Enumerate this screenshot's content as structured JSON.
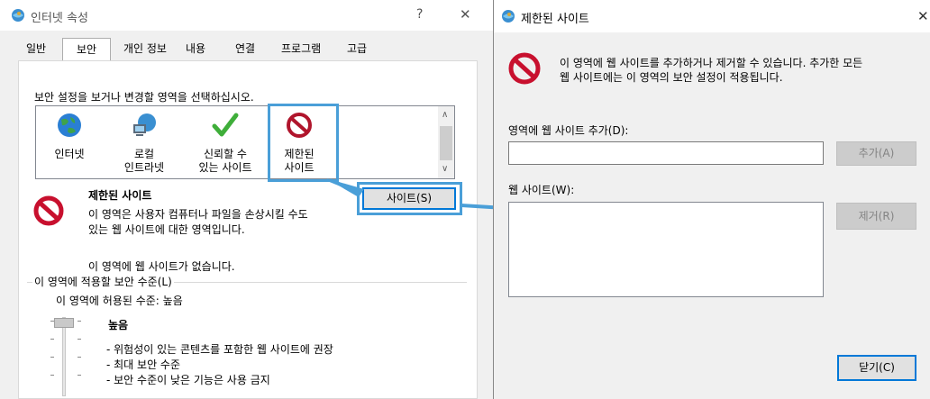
{
  "left": {
    "title": "인터넷 속성",
    "help": "?",
    "close": "✕",
    "tabs": [
      "일반",
      "보안",
      "개인 정보",
      "내용",
      "연결",
      "프로그램",
      "고급"
    ],
    "instruction": "보안 설정을 보거나 변경할 영역을 선택하십시오.",
    "zones": [
      {
        "l1": "인터넷",
        "l2": ""
      },
      {
        "l1": "로컬",
        "l2": "인트라넷"
      },
      {
        "l1": "신뢰할 수",
        "l2": "있는 사이트"
      },
      {
        "l1": "제한된",
        "l2": "사이트"
      }
    ],
    "zone_heading": "제한된 사이트",
    "zone_desc1": "이 영역은 사용자 컴퓨터나 파일을 손상시킬 수도",
    "zone_desc2": "있는 웹 사이트에 대한 영역입니다.",
    "sites_button": "사이트(S)",
    "no_sites": "이 영역에 웹 사이트가 없습니다.",
    "security_group": "이 영역에 적용할 보안 수준(L)",
    "allowed_level": "이 영역에 허용된 수준: 높음",
    "level_name": "높음",
    "bullets": [
      "- 위험성이 있는 콘텐츠를 포함한 웹 사이트에 권장",
      "- 최대 보안 수준",
      "- 보안 수준이 낮은 기능은 사용 금지"
    ]
  },
  "right": {
    "title": "제한된 사이트",
    "close": "✕",
    "info1": "이 영역에 웹 사이트를 추가하거나 제거할 수 있습니다. 추가한 모든",
    "info2": "웹 사이트에는 이 영역의 보안 설정이 적용됩니다.",
    "add_label": "영역에 웹 사이트 추가(D):",
    "add_value": "",
    "add_button": "추가(A)",
    "websites_label": "웹 사이트(W):",
    "remove_button": "제거(R)",
    "close_button": "닫기(C)"
  },
  "colors": {
    "callout": "#4a9fd8",
    "focus": "#0078d7",
    "restricted_red": "#c8102e"
  },
  "icons": [
    "globe-icon",
    "network-icon",
    "checkmark-icon",
    "restricted-icon",
    "ie-app-icon"
  ]
}
